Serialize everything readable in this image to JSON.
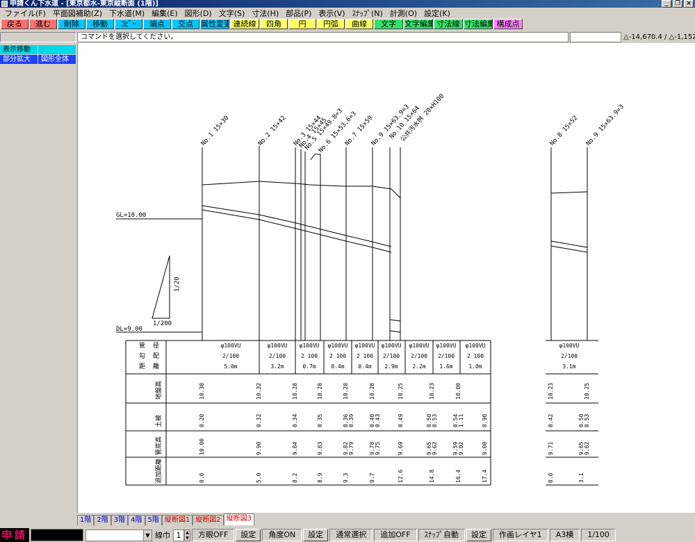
{
  "window": {
    "title": "申請くん下水道 - [東京都水-東京縦断面 (1階)]",
    "controls": [
      "_",
      "❐",
      "×"
    ]
  },
  "menu": [
    "ファイル(F)",
    "平面図補助(Z)",
    "下水道(M)",
    "編集(E)",
    "図形(D)",
    "文字(S)",
    "寸法(H)",
    "部品(P)",
    "表示(V)",
    "ｽﾅｯﾌﾟ(N)",
    "計測(O)",
    "設定(K)"
  ],
  "commands": [
    {
      "label": "戻る",
      "color": "#ff6f6f"
    },
    {
      "label": "進む",
      "color": "#ff6f6f"
    },
    {
      "label": "削除",
      "color": "#00c8ff"
    },
    {
      "label": "移動",
      "color": "#00c8ff"
    },
    {
      "label": "ｺﾋﾟｰ",
      "color": "#00c8ff"
    },
    {
      "label": "端点",
      "color": "#00c8ff"
    },
    {
      "label": "交点",
      "color": "#00c8ff"
    },
    {
      "label": "属性変更",
      "color": "#00c8ff"
    },
    {
      "label": "連続線",
      "color": "#ffff66"
    },
    {
      "label": "四角",
      "color": "#ffff66"
    },
    {
      "label": "円",
      "color": "#ffff66"
    },
    {
      "label": "円弧",
      "color": "#ffff66"
    },
    {
      "label": "曲線",
      "color": "#ffff66"
    },
    {
      "label": "文字",
      "color": "#33e36b"
    },
    {
      "label": "文字編集",
      "color": "#33e36b"
    },
    {
      "label": "寸法線",
      "color": "#33e36b"
    },
    {
      "label": "寸法編集",
      "color": "#33e36b"
    },
    {
      "label": "構成点",
      "color": "#ff80ff"
    }
  ],
  "prompt": "コマンドを選択してください。",
  "coords": "△-14,670.4 / △-1,152.3",
  "sidebar": {
    "pan": "表示移動",
    "zoom_part": "部分拡大",
    "zoom_all": "図形全体"
  },
  "drawing": {
    "gl_label": "GL=10.00",
    "dl_label": "DL=9.00",
    "slope_v": "1/20",
    "slope_h": "1/200",
    "manholes": [
      "No.1 15×30",
      "No.2 15×42",
      "No.3 15×44",
      "No.4 15×45",
      "No.5 15×49.8=3",
      "No.6 15×53.6=3",
      "No.7 15×59",
      "No.9 15×63.9=3",
      "No.10 15×64",
      "公共汚水桝 20×H100",
      "No.8 15×52",
      "No.9 15×63.9=3"
    ],
    "row_headers": {
      "pipe": [
        "管",
        "勾",
        "距"
      ],
      "pipe2": [
        "径",
        "配",
        "離"
      ],
      "ground": "地盤高",
      "cover": "土被",
      "invert": "管底高",
      "cumulative": "追加距離"
    },
    "pipes": [
      {
        "dia": "φ100VU",
        "slope": "2/100",
        "len": "5.0m"
      },
      {
        "dia": "φ100VU",
        "slope": "2/100",
        "len": "3.2m"
      },
      {
        "dia": "φ100VU",
        "slope": "2 100",
        "len": "0.7m"
      },
      {
        "dia": "φ100VU",
        "slope": "2 100",
        "len": "0.4m"
      },
      {
        "dia": "φ100VU",
        "slope": "2 100",
        "len": "0.4m"
      },
      {
        "dia": "φ100VU",
        "slope": "2/100",
        "len": "2.9m"
      },
      {
        "dia": "φ100VU",
        "slope": "2/100",
        "len": "2.2m"
      },
      {
        "dia": "φ100VU",
        "slope": "2/100",
        "len": "1.6m"
      },
      {
        "dia": "φ100VU",
        "slope": "2 100",
        "len": "1.0m"
      },
      {
        "dia": "φ100VU",
        "slope": "2/100",
        "len": "3.1m"
      }
    ],
    "ground_values": [
      "10.30",
      "10.32",
      "10.28",
      "10.28",
      "10.28",
      "10.28",
      "10.25",
      "10.23",
      "10.00",
      "10.23",
      "10.25"
    ],
    "cover_values": [
      "0.20",
      "0.32",
      "0.34",
      "0.35",
      "0.36",
      "0.39",
      "0.40",
      "0.43",
      "0.49",
      "0.50",
      "0.53",
      "0.54",
      "1.11",
      "0.90",
      "0.42",
      "0.50",
      "0.53"
    ],
    "invert_values": [
      "10.00",
      "9.90",
      "9.84",
      "9.83",
      "9.82",
      "9.79",
      "9.78",
      "9.75",
      "9.69",
      "9.65",
      "9.62",
      "9.59",
      "9.02",
      "9.00",
      "9.71",
      "9.65",
      "9.62"
    ],
    "cumulative_values": [
      "0.0",
      "5.0",
      "8.2",
      "8.9",
      "9.3",
      "9.7",
      "12.6",
      "14.8",
      "16.4",
      "17.4",
      "0.0",
      "3.1"
    ]
  },
  "tabs": [
    {
      "label": "1階",
      "color": "#0000cc"
    },
    {
      "label": "2階",
      "color": "#0000cc"
    },
    {
      "label": "3階",
      "color": "#0000cc"
    },
    {
      "label": "4階",
      "color": "#0000cc"
    },
    {
      "label": "5階",
      "color": "#0000cc"
    },
    {
      "label": "縦断図1",
      "color": "#cc0000"
    },
    {
      "label": "縦断図2",
      "color": "#cc0000"
    },
    {
      "label": "縦断図3",
      "color": "#cc0000"
    }
  ],
  "active_tab": "縦断図3",
  "status": {
    "brand": "申請",
    "line_width_label": "線巾",
    "line_width_value": "1",
    "ortho": "方眼OFF",
    "set": "設定",
    "angle": "角度ON",
    "select": "通常選択",
    "add": "追加OFF",
    "snap": "ｽﾅｯﾌﾟ自動",
    "layer": "作画レイヤ1",
    "paper": "A3横",
    "scale": "1/100"
  }
}
